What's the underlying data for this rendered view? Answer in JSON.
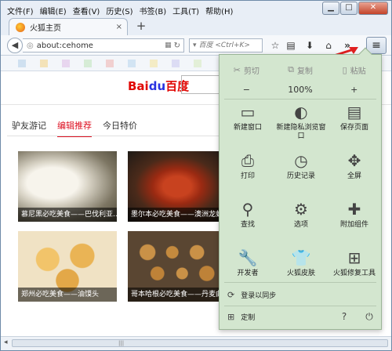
{
  "menubar": {
    "items": [
      "文件(F)",
      "编辑(E)",
      "查看(V)",
      "历史(S)",
      "书签(B)",
      "工具(T)",
      "帮助(H)"
    ]
  },
  "window_controls": {
    "minimize": "▁",
    "maximize": "□",
    "close": "✕"
  },
  "tab": {
    "title": "火狐主页",
    "close": "×",
    "new_tab": "+"
  },
  "navbar": {
    "back": "◀",
    "url": "about:cehome",
    "search_placeholder": "百度 <Ctrl+K>",
    "overflow": "»",
    "menu_button": "≡"
  },
  "page": {
    "logo_bai": "Bai",
    "logo_du": "du",
    "logo_cn": "百度",
    "tabs": [
      "驴友游记",
      "编辑推荐",
      "今日特价"
    ],
    "active_tab": 1,
    "cards": [
      {
        "caption": "慕尼黑必吃美食——巴伐利亚..."
      },
      {
        "caption": "墨尔本必吃美食——澳洲龙虾..."
      },
      {
        "caption": "郑州必吃美食——油馍头"
      },
      {
        "caption": "哥本哈根必吃美食——丹麦曲..."
      }
    ]
  },
  "panel": {
    "cut": "剪切",
    "copy": "复制",
    "paste": "粘贴",
    "zoom_out": "−",
    "zoom_value": "100%",
    "zoom_in": "+",
    "items": [
      {
        "label": "新建窗口",
        "icon": "window-icon"
      },
      {
        "label": "新建隐私浏览窗口",
        "icon": "mask-icon"
      },
      {
        "label": "保存页面",
        "icon": "save-page-icon"
      },
      {
        "label": "打印",
        "icon": "printer-icon"
      },
      {
        "label": "历史记录",
        "icon": "clock-icon"
      },
      {
        "label": "全屏",
        "icon": "fullscreen-icon"
      },
      {
        "label": "查找",
        "icon": "search-icon"
      },
      {
        "label": "选项",
        "icon": "gear-icon"
      },
      {
        "label": "附加组件",
        "icon": "puzzle-icon"
      },
      {
        "label": "开发者",
        "icon": "wrench-icon"
      },
      {
        "label": "火狐皮肤",
        "icon": "shirt-icon"
      },
      {
        "label": "火狐修复工具",
        "icon": "toolbox-icon"
      }
    ],
    "sync": "登录以同步",
    "customize": "定制"
  },
  "colors": {
    "panel_bg": "#d3e6cf",
    "accent_red": "#d12",
    "baidu_red": "#e10602",
    "baidu_blue": "#2932e1"
  }
}
